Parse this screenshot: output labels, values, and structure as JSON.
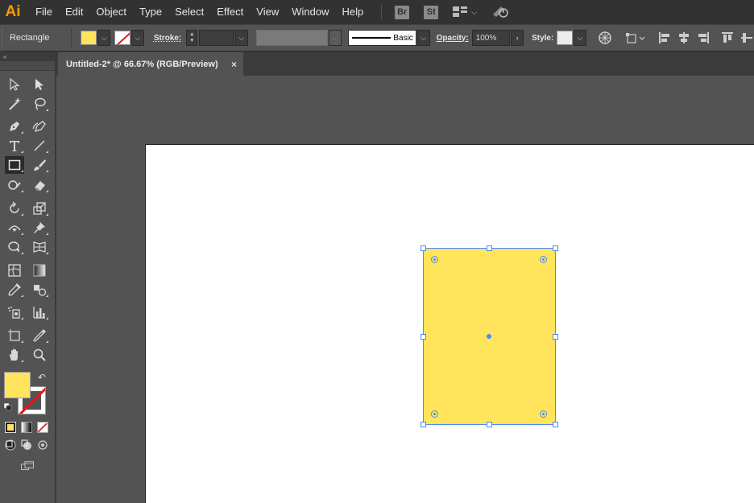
{
  "app": {
    "logo": "Ai",
    "accent_color": "#ff9a00"
  },
  "menu": {
    "items": [
      "File",
      "Edit",
      "Object",
      "Type",
      "Select",
      "Effect",
      "View",
      "Window",
      "Help"
    ],
    "bridge_label": "Br",
    "stock_label": "St"
  },
  "control_bar": {
    "tool_name": "Rectangle",
    "stroke_label": "Stroke:",
    "brush_label": "Basic",
    "opacity_label": "Opacity:",
    "opacity_value": "100%",
    "style_label": "Style:"
  },
  "document_tab": {
    "title": "Untitled-2* @ 66.67% (RGB/Preview)",
    "close_symbol": "×"
  },
  "toolbox": {
    "fill_color": "#ffe45c",
    "stroke_color": "none"
  },
  "shape": {
    "fill_color": "#ffe45c",
    "selection_color": "#4a8cf7"
  }
}
